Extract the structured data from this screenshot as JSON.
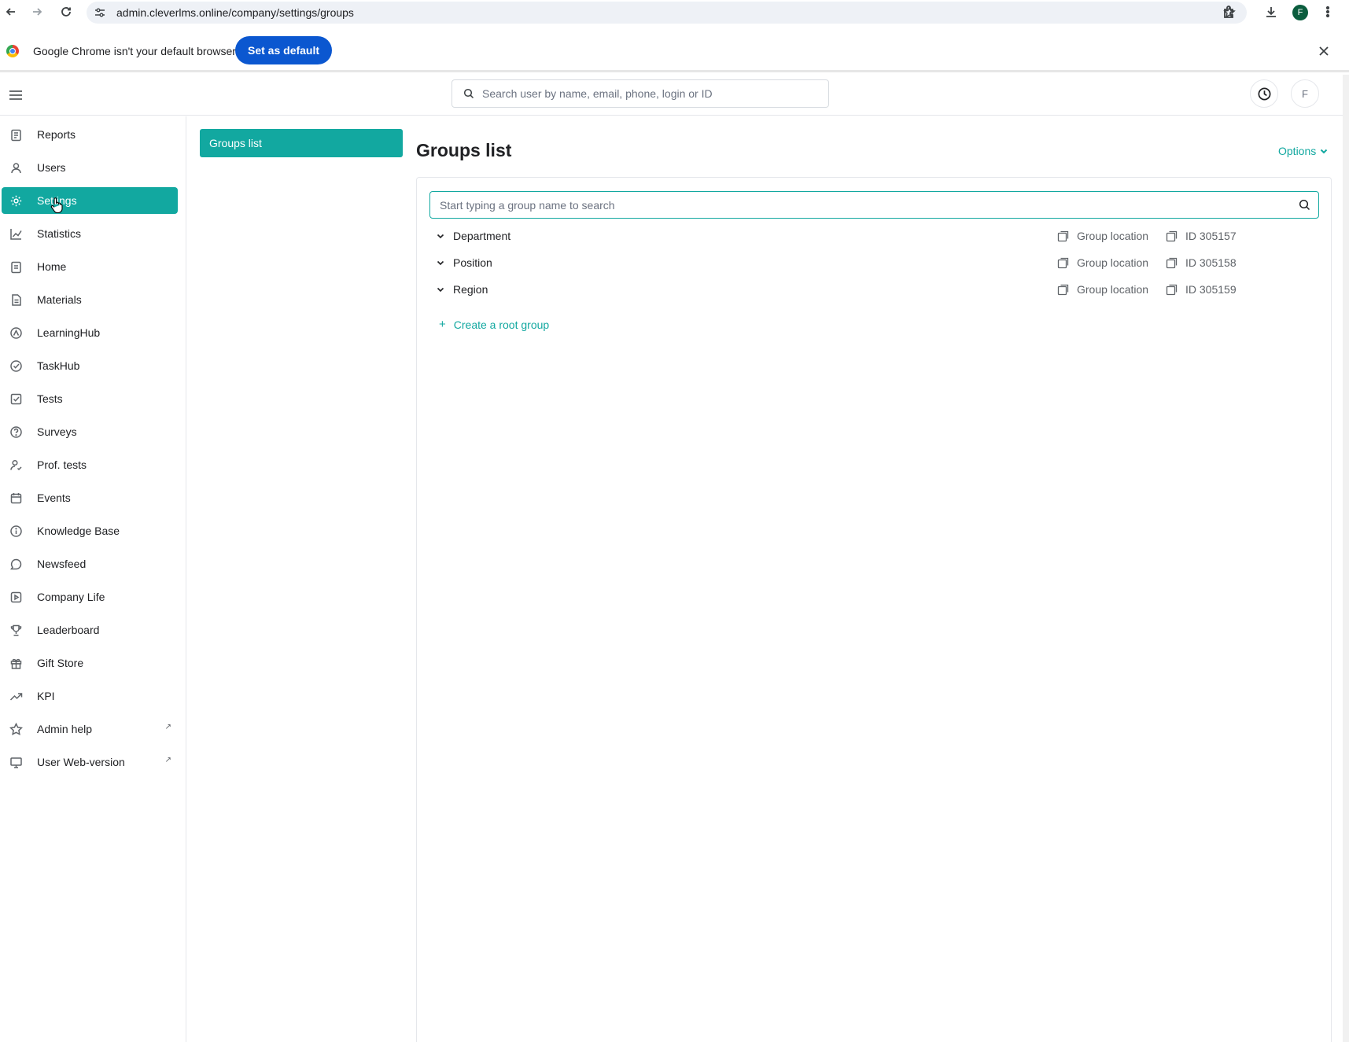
{
  "browser": {
    "url": "admin.cleverlms.online/company/settings/groups",
    "infobar_text": "Google Chrome isn't your default browser",
    "set_default_label": "Set as default",
    "profile_initial": "F"
  },
  "header": {
    "search_placeholder": "Search user by name, email, phone, login or ID",
    "avatar_initial": "F"
  },
  "sidebar": {
    "items": [
      {
        "label": "Reports",
        "icon": "reports-icon"
      },
      {
        "label": "Users",
        "icon": "users-icon"
      },
      {
        "label": "Settings",
        "icon": "gear-icon",
        "active": true
      },
      {
        "label": "Statistics",
        "icon": "chart-icon"
      },
      {
        "label": "Home",
        "icon": "home-icon"
      },
      {
        "label": "Materials",
        "icon": "document-icon"
      },
      {
        "label": "LearningHub",
        "icon": "learning-icon"
      },
      {
        "label": "TaskHub",
        "icon": "check-circle-icon"
      },
      {
        "label": "Tests",
        "icon": "test-icon"
      },
      {
        "label": "Surveys",
        "icon": "question-icon"
      },
      {
        "label": "Prof. tests",
        "icon": "person-check-icon"
      },
      {
        "label": "Events",
        "icon": "calendar-icon"
      },
      {
        "label": "Knowledge Base",
        "icon": "info-icon"
      },
      {
        "label": "Newsfeed",
        "icon": "chat-icon"
      },
      {
        "label": "Company Life",
        "icon": "play-icon"
      },
      {
        "label": "Leaderboard",
        "icon": "trophy-icon"
      },
      {
        "label": "Gift Store",
        "icon": "gift-icon"
      },
      {
        "label": "KPI",
        "icon": "trend-icon"
      },
      {
        "label": "Admin help",
        "icon": "star-icon",
        "external": true
      },
      {
        "label": "User Web-version",
        "icon": "monitor-icon",
        "external": true
      }
    ],
    "external_glyph": "↗"
  },
  "subnav": {
    "active_label": "Groups list"
  },
  "main": {
    "title": "Groups list",
    "options_label": "Options",
    "group_search_placeholder": "Start typing a group name to search",
    "groups": [
      {
        "name": "Department",
        "location_label": "Group location",
        "id_label": "ID 305157"
      },
      {
        "name": "Position",
        "location_label": "Group location",
        "id_label": "ID 305158"
      },
      {
        "name": "Region",
        "location_label": "Group location",
        "id_label": "ID 305159"
      }
    ],
    "create_root_label": "Create a root group",
    "plus_glyph": "+"
  },
  "colors": {
    "accent": "#12a8a0",
    "chrome_button": "#0b57d0"
  }
}
